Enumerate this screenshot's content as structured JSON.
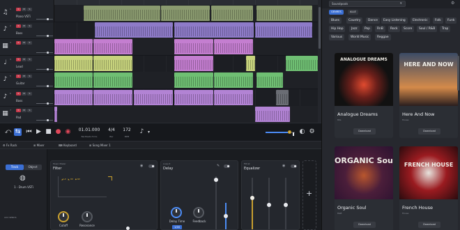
{
  "tracks": [
    {
      "name": "Piano VSTi",
      "icon": "♫",
      "icon_name": "piano-icon"
    },
    {
      "name": "Bass",
      "icon": "♪",
      "icon_name": "bass-guitar-icon"
    },
    {
      "name": "",
      "icon": "▦",
      "icon_name": "drum-machine-icon"
    },
    {
      "name": "Lead",
      "icon": "♩",
      "icon_name": "synth-icon"
    },
    {
      "name": "Guitar",
      "icon": "♪",
      "icon_name": "guitar-icon"
    },
    {
      "name": "Bass",
      "icon": "♪",
      "icon_name": "bass-guitar-icon"
    },
    {
      "name": "Pad",
      "icon": "▦",
      "icon_name": "keyboard-icon"
    }
  ],
  "track_buttons": {
    "mute": "M",
    "solo": "S",
    "rec": "R"
  },
  "transport": {
    "time": "01.01.000",
    "time_label": "Bar.Beats.Ticks",
    "signature": "4/4",
    "signature_label": "Bar",
    "tempo": "172",
    "tempo_label": "BPM",
    "master_volume": 0.82
  },
  "browser_tabs": [
    "Fx Rack",
    "Mixer",
    "Keyboard",
    "Song Mixer 1"
  ],
  "instrument_panel": {
    "seg_track": "Track",
    "seg_object": "Object",
    "instrument": "1 - Drum VSTi",
    "aux": "AUX SENDS"
  },
  "devices": [
    {
      "top": "Music Maker",
      "title": "Filter",
      "knobs": [
        "Cutoff",
        "Resonance"
      ]
    },
    {
      "top": "Loop-It",
      "title": "Delay",
      "knobs": [
        "Delay Time",
        "Feedback"
      ],
      "value_badge": "1/16"
    },
    {
      "top": "Filtrat",
      "title": "Equalizer"
    }
  ],
  "sound_panel": {
    "search_placeholder": "Soundpools",
    "filter_chips": [
      "GENRES",
      "ALLE"
    ],
    "genres": [
      "Blues",
      "Country",
      "Dance",
      "Easy Listening",
      "Electronic",
      "Folk",
      "Funk",
      "Hip Hop",
      "Jazz",
      "Pop",
      "RnB",
      "Rock",
      "Score",
      "Soul / R&B",
      "Trap",
      "Various",
      "World Music",
      "Reggae"
    ],
    "cards": [
      {
        "title": "Analogue Dreams",
        "sub": "80s",
        "art_title": "ANALOGUE DREAMS",
        "button": "Download"
      },
      {
        "title": "Here And Now",
        "sub": "House",
        "art_title": "HERE AND NOW",
        "button": "Download"
      },
      {
        "title": "Organic Soul",
        "sub": "R&B",
        "art_title": "ORGANIC Soul",
        "button": "Download"
      },
      {
        "title": "French House",
        "sub": "House",
        "art_title": "FRENCH HOUSE",
        "button": "Download"
      }
    ]
  },
  "colors": {
    "accent": "#3b6fd4",
    "record": "#e0485a",
    "knob_gold": "#c9a02f"
  }
}
